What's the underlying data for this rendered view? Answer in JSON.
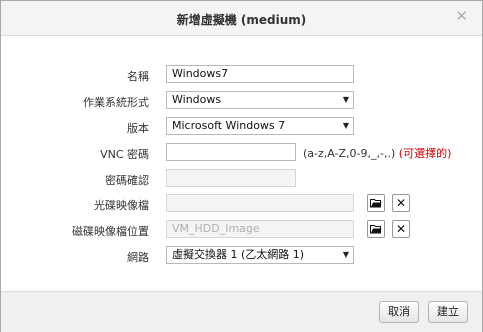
{
  "dialog": {
    "title": "新增虛擬機 (medium)",
    "close_glyph": "✕"
  },
  "form": {
    "name": {
      "label": "名稱",
      "value": "Windows7"
    },
    "os_type": {
      "label": "作業系統形式",
      "value": "Windows"
    },
    "version": {
      "label": "版本",
      "value": "Microsoft Windows 7"
    },
    "vnc_password": {
      "label": "VNC 密碼",
      "value": "",
      "hint": "(a-z,A-Z,0-9,_,-,.)",
      "hint_optional": "(可選擇的)"
    },
    "confirm_password": {
      "label": "密碼確認",
      "value": ""
    },
    "cd_image": {
      "label": "光碟映像檔",
      "value": ""
    },
    "disk_image": {
      "label": "磁碟映像檔位置",
      "placeholder": "VM_HDD_Image"
    },
    "network": {
      "label": "網路",
      "value": "虛擬交換器 1 (乙太網路 1)"
    }
  },
  "footer": {
    "cancel_label": "取消",
    "create_label": "建立"
  },
  "icons": {
    "folder": "folder-open-icon",
    "remove": "remove-x-icon"
  }
}
